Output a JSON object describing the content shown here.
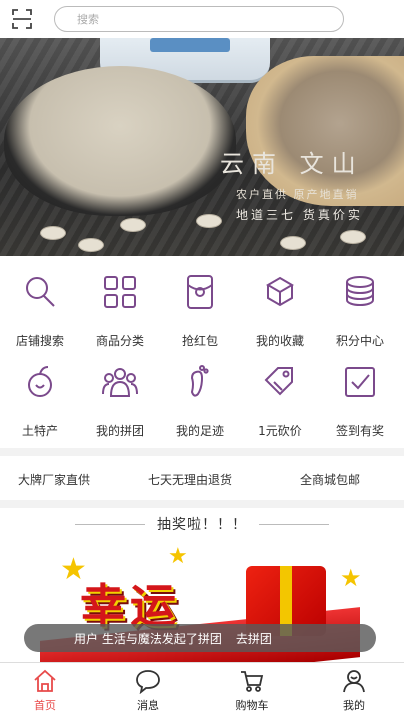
{
  "search": {
    "placeholder": "搜索"
  },
  "banner": {
    "title": "云南  文山",
    "line1": "农户直供  原产地直销",
    "line2": "地道三七  货真价实"
  },
  "icon_grid": [
    {
      "label": "店铺搜索",
      "icon": "shop-search-icon"
    },
    {
      "label": "商品分类",
      "icon": "category-icon"
    },
    {
      "label": "抢红包",
      "icon": "red-packet-icon"
    },
    {
      "label": "我的收藏",
      "icon": "favorites-icon"
    },
    {
      "label": "积分中心",
      "icon": "points-icon"
    },
    {
      "label": "土特产",
      "icon": "local-specialty-icon"
    },
    {
      "label": "我的拼团",
      "icon": "group-buy-icon"
    },
    {
      "label": "我的足迹",
      "icon": "footprint-icon"
    },
    {
      "label": "1元砍价",
      "icon": "bargain-tag-icon"
    },
    {
      "label": "签到有奖",
      "icon": "checkin-icon"
    }
  ],
  "promises": [
    "大牌厂家直供",
    "七天无理由退货",
    "全商城包邮"
  ],
  "lottery": {
    "heading": "抽奖啦！！！",
    "banner_text": "幸运",
    "toast": "用户 生活与魔法发起了拼团",
    "toast_action": "去拼团"
  },
  "tabs": [
    {
      "label": "首页",
      "icon": "home-icon",
      "active": true
    },
    {
      "label": "消息",
      "icon": "message-icon",
      "active": false
    },
    {
      "label": "购物车",
      "icon": "cart-icon",
      "active": false
    },
    {
      "label": "我的",
      "icon": "profile-icon",
      "active": false
    }
  ],
  "colors": {
    "accent": "#e84a4a",
    "icon_purple": "#7b4a8c"
  }
}
